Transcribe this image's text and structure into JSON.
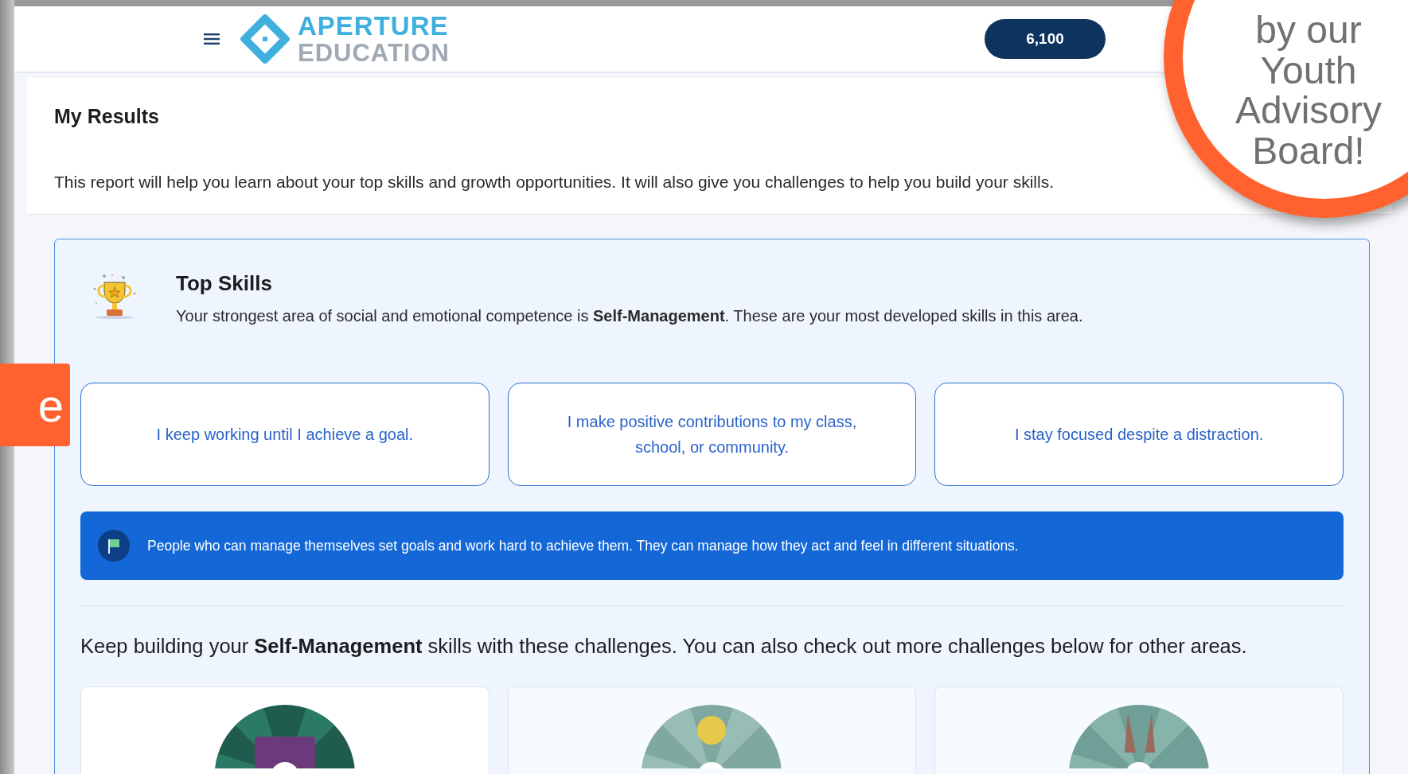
{
  "header": {
    "logo_line1": "APERTURE",
    "logo_line2": "EDUCATION",
    "points": "6,100"
  },
  "results": {
    "title": "My Results",
    "description": "This report will help you learn about your top skills and growth opportunities. It will also give you challenges to help you build your skills."
  },
  "top_skills": {
    "title": "Top Skills",
    "text": "Your strongest area of social and emotional competence is **Self-Management**. These are your most developed skills in this area.",
    "skills": [
      "I keep working until I achieve a goal.",
      "I make positive contributions to my class, school, or community.",
      "I stay focused despite a distraction."
    ],
    "banner": "People who can manage themselves set goals and work hard to achieve them. They can manage how they act and feel in different situations."
  },
  "challenges": {
    "intro": "Keep building your **Self-Management** skills with these challenges. You can also check out more challenges below for other areas."
  },
  "overlays": {
    "callout_circle": [
      "by our",
      "Youth",
      "Advisory",
      "Board!"
    ],
    "callout_tag": "e"
  }
}
